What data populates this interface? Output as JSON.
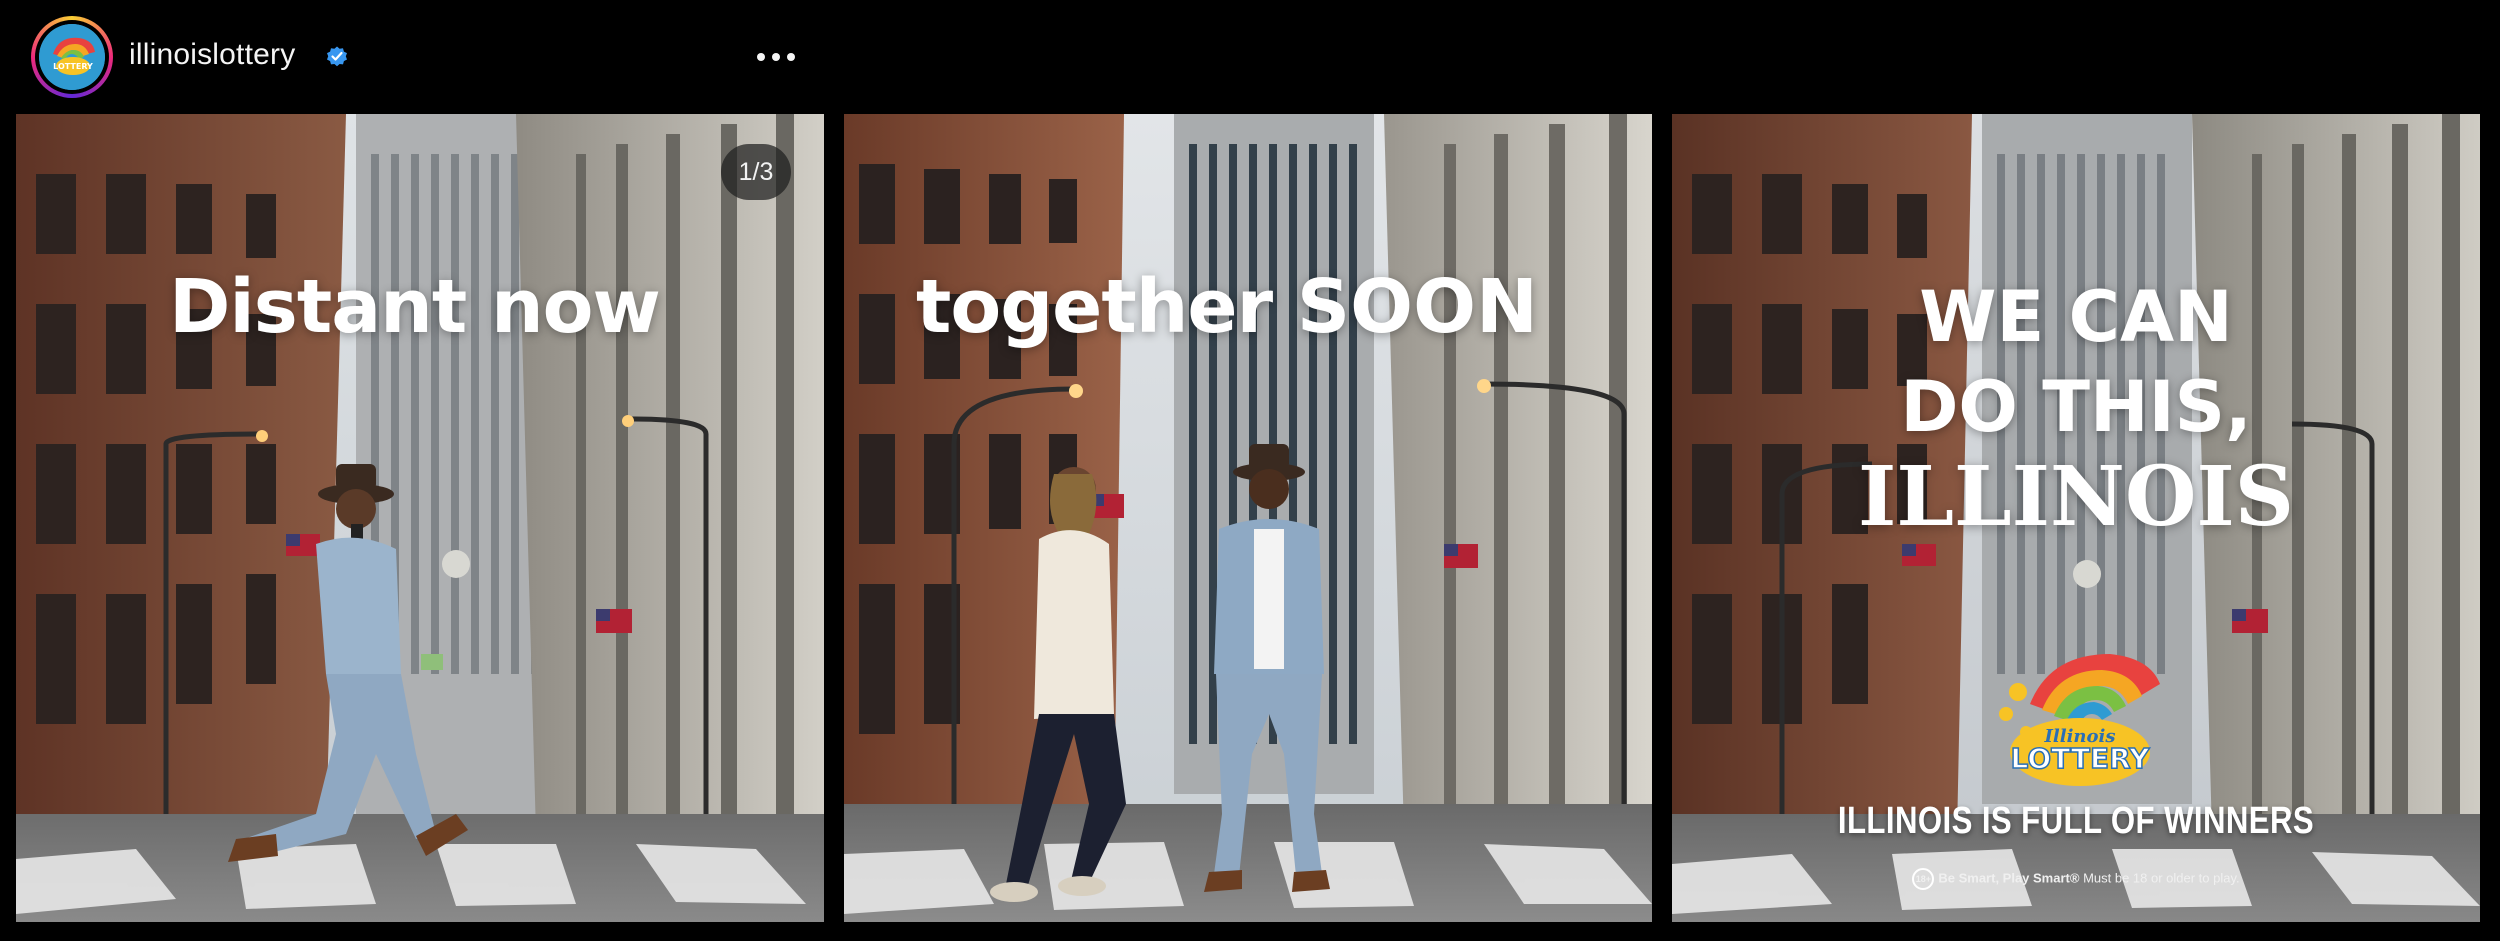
{
  "header": {
    "username": "illinoislottery",
    "verified": true,
    "verified_icon": "verified-badge-icon",
    "more_icon": "more-options-icon",
    "avatar_text": "LOTTERY"
  },
  "carousel": {
    "counter": "1/3",
    "panels": [
      {
        "headline": "Distant now"
      },
      {
        "headline_a": "together ",
        "headline_b": "SOON"
      },
      {
        "headline_lines": [
          "WE CAN",
          "DO THIS,",
          "ILLINOIS"
        ],
        "logo_line1": "Illinois",
        "logo_line2": "LOTTERY",
        "tagline": "ILLINOIS IS FULL OF WINNERS",
        "age_badge": "18+",
        "disclaimer_bold": "Be Smart, Play Smart®",
        "disclaimer": " Must be 18 or older to play."
      }
    ]
  },
  "colors": {
    "background": "#000000",
    "verified_blue": "#3897f0",
    "sky": "#c9d1d8",
    "brick": "#7a4a35",
    "stone": "#b9b6ae"
  }
}
